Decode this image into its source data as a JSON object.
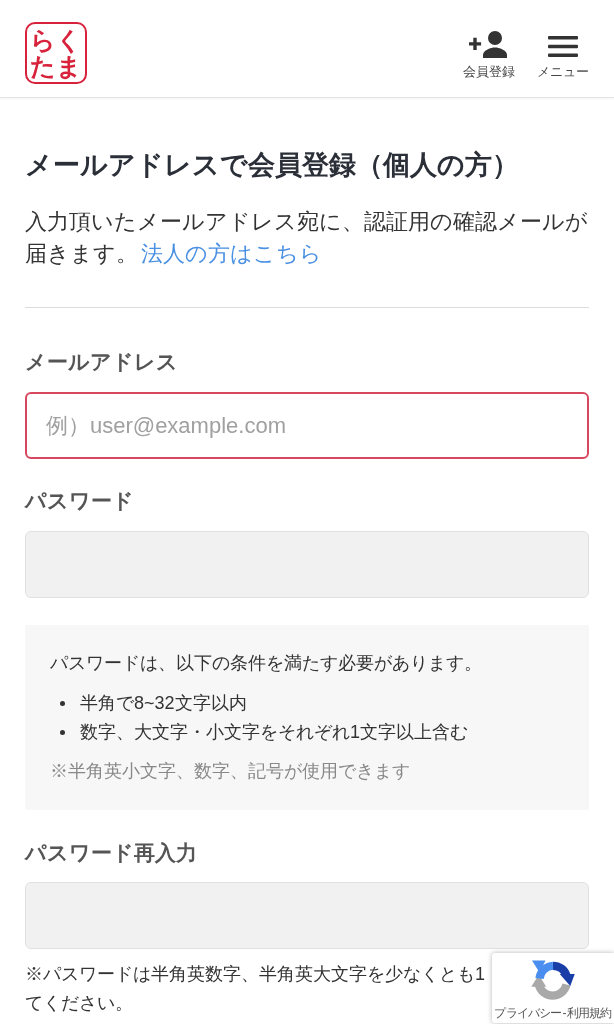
{
  "header": {
    "logo": "らくたま",
    "actions": [
      {
        "kind": "register",
        "label": "会員登録"
      },
      {
        "kind": "menu",
        "label": "メニュー"
      }
    ]
  },
  "title": "メールアドレスで会員登録（個人の方）",
  "intro": {
    "text": "入力頂いたメールアドレス宛に、認証用の確認メールが届きます。",
    "link": "法人の方はこちら"
  },
  "form": [
    {
      "kind": "field",
      "label": "メールアドレス",
      "placeholder": "例）user@example.com",
      "focused": true
    },
    {
      "kind": "field",
      "label": "パスワード",
      "focused": false
    },
    {
      "kind": "rules",
      "lead": "パスワードは、以下の条件を満たす必要があります。",
      "items": [
        "半角で8~32文字以内",
        "数字、大文字・小文字をそれぞれ1文字以上含む"
      ],
      "note": "※半角英小文字、数字、記号が使用できます"
    },
    {
      "kind": "field",
      "label": "パスワード再入力",
      "focused": false
    },
    {
      "kind": "note",
      "lines": [
        "※パスワードは半角英数字、半角英大文字を少なくとも1",
        "てください。"
      ]
    }
  ],
  "captcha_badge": {
    "links": [
      "プライバシー",
      "利用規約"
    ],
    "separator": "-"
  }
}
